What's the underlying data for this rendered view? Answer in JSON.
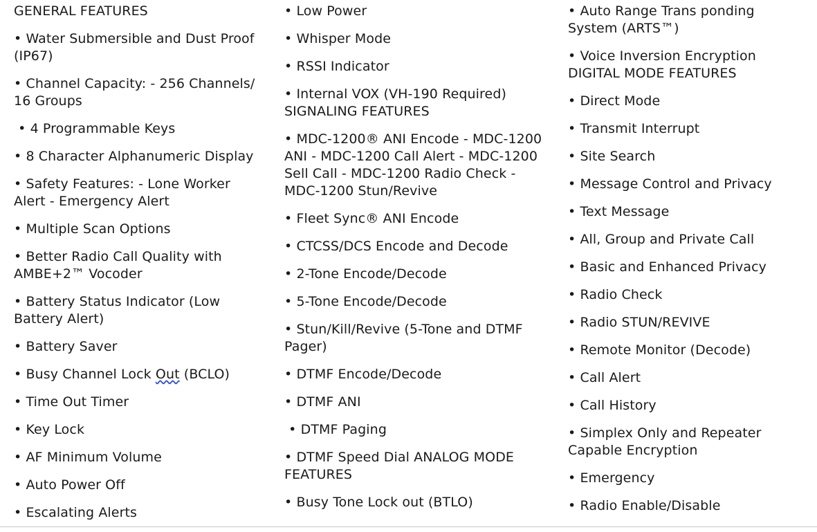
{
  "page": {
    "background_color": "#ffffff",
    "text_color": "#1a1a1a",
    "spellcheck_underline_color": "#2a4fd8",
    "rule_color": "#c8c8c8"
  },
  "columns": [
    {
      "id": "general-features",
      "heading": "GENERAL FEATURES",
      "items": [
        "• Water Submersible and Dust Proof (IP67)",
        "• Channel Capacity: - 256 Channels/ 16 Groups",
        " • 4 Programmable Keys",
        "• 8 Character Alphanumeric Display",
        "• Safety Features: - Lone Worker Alert - Emergency Alert",
        "• Multiple Scan Options",
        "• Better Radio Call Quality with AMBE+2™ Vocoder",
        "• Battery Status Indicator (Low Battery Alert)",
        "• Battery Saver",
        "• Busy Channel Lock Out (BCLO)",
        "• Time Out Timer",
        "• Key Lock",
        "• AF Minimum Volume",
        "• Auto Power Off",
        "• Escalating Alerts"
      ],
      "misspelled_item_index": 9,
      "misspelled_word": "Out"
    },
    {
      "id": "signaling-features",
      "heading": "",
      "items": [
        "• Low Power",
        "• Whisper Mode",
        "• RSSI Indicator",
        "• Internal VOX (VH-190 Required) SIGNALING FEATURES",
        "• MDC-1200® ANI Encode - MDC-1200 ANI - MDC-1200 Call Alert - MDC-1200 Sell Call - MDC-1200 Radio Check - MDC-1200 Stun/Revive",
        "• Fleet Sync® ANI Encode",
        "• CTCSS/DCS Encode and Decode",
        "• 2-Tone Encode/Decode",
        "• 5-Tone Encode/Decode",
        "• Stun/Kill/Revive (5-Tone and DTMF Pager)",
        "• DTMF Encode/Decode",
        "• DTMF ANI",
        " • DTMF Paging",
        "• DTMF Speed Dial ANALOG MODE FEATURES",
        "• Busy Tone Lock out (BTLO)"
      ]
    },
    {
      "id": "digital-mode-features",
      "heading": "",
      "items": [
        "• Auto Range Trans ponding System (ARTS™)",
        "• Voice Inversion Encryption DIGITAL MODE FEATURES",
        "• Direct Mode",
        "• Transmit Interrupt",
        "• Site Search",
        "• Message Control and Privacy",
        "• Text Message",
        "• All, Group and Private Call",
        "• Basic and Enhanced Privacy",
        "• Radio Check",
        "• Radio STUN/REVIVE",
        "• Remote Monitor (Decode)",
        "• Call Alert",
        "• Call History",
        "• Simplex Only and Repeater Capable Encryption",
        "• Emergency",
        "• Radio Enable/Disable"
      ]
    }
  ]
}
